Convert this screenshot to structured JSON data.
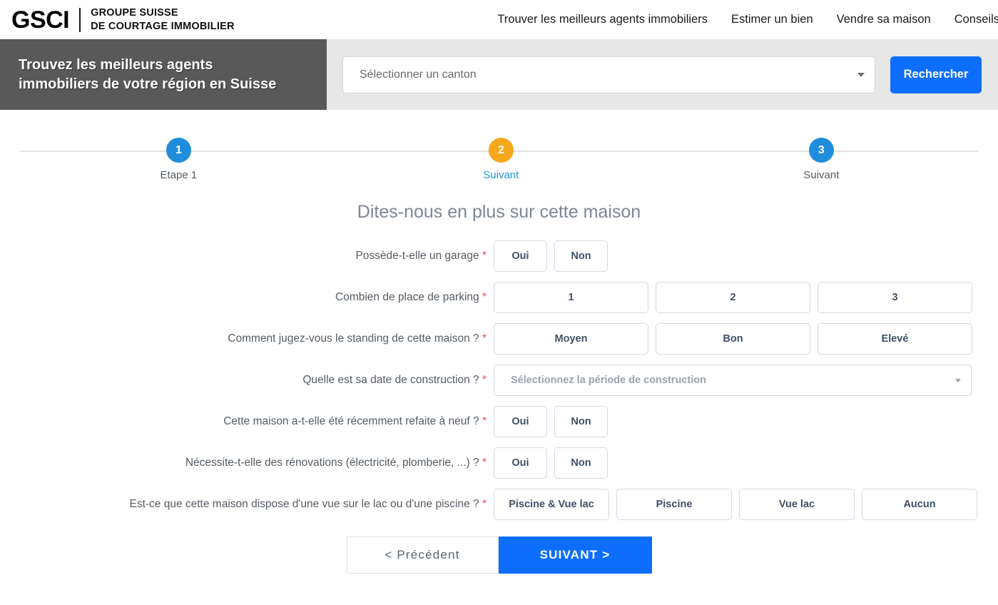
{
  "header": {
    "brand_mark": "GSCI",
    "brand_tagline_line1": "GROUPE SUISSE",
    "brand_tagline_line2": "DE COURTAGE IMMOBILIER",
    "nav": [
      {
        "label": "Trouver les meilleurs agents immobiliers"
      },
      {
        "label": "Estimer un bien"
      },
      {
        "label": "Vendre sa maison"
      },
      {
        "label": "Conseils"
      }
    ]
  },
  "search_banner": {
    "title_line1": "Trouvez les meilleurs agents",
    "title_line2": "immobiliers de votre région en Suisse",
    "canton_placeholder": "Sélectionner un canton",
    "canton_value": "",
    "search_button": "Rechercher",
    "banner_bg": "#595959",
    "strip_bg": "#e8e8e8",
    "button_color": "#0d6efd"
  },
  "stepper": {
    "steps": [
      {
        "number": "1",
        "label": "Etape 1",
        "color": "#1f8ddb",
        "label_color": "#555c63",
        "left_pct": 17.9
      },
      {
        "number": "2",
        "label": "Suivant",
        "color": "#f5a81c",
        "label_color": "#2196d8",
        "left_pct": 50.2
      },
      {
        "number": "3",
        "label": "Suivant",
        "color": "#1f8ddb",
        "label_color": "#555c63",
        "left_pct": 82.3
      }
    ]
  },
  "form": {
    "heading": "Dites-nous en plus sur cette maison",
    "required_marker": "*",
    "rows": [
      {
        "label": "Possède-t-elle un garage",
        "type": "buttons",
        "size": "w-small",
        "options": [
          "Oui",
          "Non"
        ]
      },
      {
        "label": "Combien de place de parking",
        "type": "buttons",
        "size": "w-third",
        "options": [
          "1",
          "2",
          "3"
        ]
      },
      {
        "label": "Comment jugez-vous le standing de cette maison ?",
        "type": "buttons",
        "size": "w-third",
        "options": [
          "Moyen",
          "Bon",
          "Elevé"
        ]
      },
      {
        "label": "Quelle est sa date de construction ?",
        "type": "select",
        "placeholder": "Sélectionnez la période de construction",
        "value": ""
      },
      {
        "label": "Cette maison a-t-elle été récemment refaite à neuf ?",
        "type": "buttons",
        "size": "w-small",
        "options": [
          "Oui",
          "Non"
        ]
      },
      {
        "label": "Nécessite-t-elle des rénovations (électricité, plomberie, ...) ?",
        "type": "buttons",
        "size": "w-small",
        "options": [
          "Oui",
          "Non"
        ]
      },
      {
        "label": "Est-ce que cette maison dispose d'une vue sur le lac ou d'une piscine ?",
        "type": "buttons",
        "size": "w-quarter",
        "options": [
          "Piscine & Vue lac",
          "Piscine",
          "Vue lac",
          "Aucun"
        ]
      }
    ],
    "prev_button": "<  Précédent",
    "next_button": "SUIVANT  >"
  }
}
